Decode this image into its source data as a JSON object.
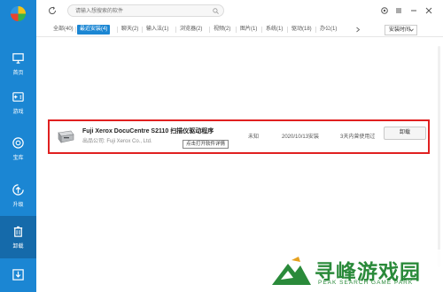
{
  "sidebar": {
    "items": [
      {
        "label": "首页",
        "icon": "monitor-icon"
      },
      {
        "label": "游戏",
        "icon": "gamepad-icon"
      },
      {
        "label": "宝库",
        "icon": "treasure-icon"
      },
      {
        "label": "升级",
        "icon": "upgrade-icon"
      },
      {
        "label": "卸载",
        "icon": "trash-icon",
        "active": true
      },
      {
        "label": "",
        "icon": "download-icon"
      }
    ]
  },
  "search": {
    "placeholder": "请输入想搜索的软件"
  },
  "tabs": [
    {
      "label": "全部(40)"
    },
    {
      "label": "最近安装(4)",
      "active": true
    },
    {
      "label": "聊天(2)"
    },
    {
      "label": "输入法(1)"
    },
    {
      "label": "浏览器(2)"
    },
    {
      "label": "视频(2)"
    },
    {
      "label": "图片(1)"
    },
    {
      "label": "系统(1)"
    },
    {
      "label": "驱动(18)"
    },
    {
      "label": "办公(1)"
    }
  ],
  "sort": {
    "label": "安装时间"
  },
  "app": {
    "title": "Fuji Xerox DocuCentre S2110 扫描仪驱动程序",
    "publisher": "出品公司: Fuji Xerox Co., Ltd.",
    "version": "未知",
    "install_date": "2020/10/13安装",
    "usage": "3天内曾使用过",
    "uninstall_label": "卸载",
    "tooltip": "点击打开软件详情"
  },
  "watermark": {
    "title": "寻峰游戏园",
    "subtitle": "PEAK SEARCH GAME PARK"
  },
  "colors": {
    "accent": "#1b86d3",
    "highlight": "#e02020",
    "watermark": "#2a8a3a"
  }
}
